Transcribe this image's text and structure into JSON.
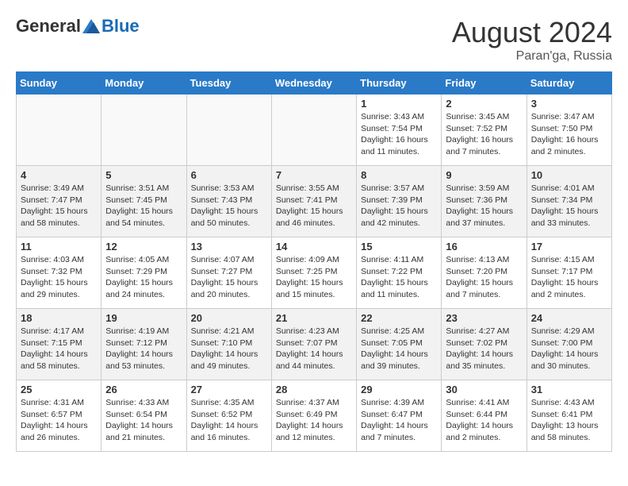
{
  "header": {
    "logo_general": "General",
    "logo_blue": "Blue",
    "month_title": "August 2024",
    "location": "Paran'ga, Russia"
  },
  "days_of_week": [
    "Sunday",
    "Monday",
    "Tuesday",
    "Wednesday",
    "Thursday",
    "Friday",
    "Saturday"
  ],
  "weeks": [
    [
      {
        "day": "",
        "info": ""
      },
      {
        "day": "",
        "info": ""
      },
      {
        "day": "",
        "info": ""
      },
      {
        "day": "",
        "info": ""
      },
      {
        "day": "1",
        "info": "Sunrise: 3:43 AM\nSunset: 7:54 PM\nDaylight: 16 hours\nand 11 minutes."
      },
      {
        "day": "2",
        "info": "Sunrise: 3:45 AM\nSunset: 7:52 PM\nDaylight: 16 hours\nand 7 minutes."
      },
      {
        "day": "3",
        "info": "Sunrise: 3:47 AM\nSunset: 7:50 PM\nDaylight: 16 hours\nand 2 minutes."
      }
    ],
    [
      {
        "day": "4",
        "info": "Sunrise: 3:49 AM\nSunset: 7:47 PM\nDaylight: 15 hours\nand 58 minutes."
      },
      {
        "day": "5",
        "info": "Sunrise: 3:51 AM\nSunset: 7:45 PM\nDaylight: 15 hours\nand 54 minutes."
      },
      {
        "day": "6",
        "info": "Sunrise: 3:53 AM\nSunset: 7:43 PM\nDaylight: 15 hours\nand 50 minutes."
      },
      {
        "day": "7",
        "info": "Sunrise: 3:55 AM\nSunset: 7:41 PM\nDaylight: 15 hours\nand 46 minutes."
      },
      {
        "day": "8",
        "info": "Sunrise: 3:57 AM\nSunset: 7:39 PM\nDaylight: 15 hours\nand 42 minutes."
      },
      {
        "day": "9",
        "info": "Sunrise: 3:59 AM\nSunset: 7:36 PM\nDaylight: 15 hours\nand 37 minutes."
      },
      {
        "day": "10",
        "info": "Sunrise: 4:01 AM\nSunset: 7:34 PM\nDaylight: 15 hours\nand 33 minutes."
      }
    ],
    [
      {
        "day": "11",
        "info": "Sunrise: 4:03 AM\nSunset: 7:32 PM\nDaylight: 15 hours\nand 29 minutes."
      },
      {
        "day": "12",
        "info": "Sunrise: 4:05 AM\nSunset: 7:29 PM\nDaylight: 15 hours\nand 24 minutes."
      },
      {
        "day": "13",
        "info": "Sunrise: 4:07 AM\nSunset: 7:27 PM\nDaylight: 15 hours\nand 20 minutes."
      },
      {
        "day": "14",
        "info": "Sunrise: 4:09 AM\nSunset: 7:25 PM\nDaylight: 15 hours\nand 15 minutes."
      },
      {
        "day": "15",
        "info": "Sunrise: 4:11 AM\nSunset: 7:22 PM\nDaylight: 15 hours\nand 11 minutes."
      },
      {
        "day": "16",
        "info": "Sunrise: 4:13 AM\nSunset: 7:20 PM\nDaylight: 15 hours\nand 7 minutes."
      },
      {
        "day": "17",
        "info": "Sunrise: 4:15 AM\nSunset: 7:17 PM\nDaylight: 15 hours\nand 2 minutes."
      }
    ],
    [
      {
        "day": "18",
        "info": "Sunrise: 4:17 AM\nSunset: 7:15 PM\nDaylight: 14 hours\nand 58 minutes."
      },
      {
        "day": "19",
        "info": "Sunrise: 4:19 AM\nSunset: 7:12 PM\nDaylight: 14 hours\nand 53 minutes."
      },
      {
        "day": "20",
        "info": "Sunrise: 4:21 AM\nSunset: 7:10 PM\nDaylight: 14 hours\nand 49 minutes."
      },
      {
        "day": "21",
        "info": "Sunrise: 4:23 AM\nSunset: 7:07 PM\nDaylight: 14 hours\nand 44 minutes."
      },
      {
        "day": "22",
        "info": "Sunrise: 4:25 AM\nSunset: 7:05 PM\nDaylight: 14 hours\nand 39 minutes."
      },
      {
        "day": "23",
        "info": "Sunrise: 4:27 AM\nSunset: 7:02 PM\nDaylight: 14 hours\nand 35 minutes."
      },
      {
        "day": "24",
        "info": "Sunrise: 4:29 AM\nSunset: 7:00 PM\nDaylight: 14 hours\nand 30 minutes."
      }
    ],
    [
      {
        "day": "25",
        "info": "Sunrise: 4:31 AM\nSunset: 6:57 PM\nDaylight: 14 hours\nand 26 minutes."
      },
      {
        "day": "26",
        "info": "Sunrise: 4:33 AM\nSunset: 6:54 PM\nDaylight: 14 hours\nand 21 minutes."
      },
      {
        "day": "27",
        "info": "Sunrise: 4:35 AM\nSunset: 6:52 PM\nDaylight: 14 hours\nand 16 minutes."
      },
      {
        "day": "28",
        "info": "Sunrise: 4:37 AM\nSunset: 6:49 PM\nDaylight: 14 hours\nand 12 minutes."
      },
      {
        "day": "29",
        "info": "Sunrise: 4:39 AM\nSunset: 6:47 PM\nDaylight: 14 hours\nand 7 minutes."
      },
      {
        "day": "30",
        "info": "Sunrise: 4:41 AM\nSunset: 6:44 PM\nDaylight: 14 hours\nand 2 minutes."
      },
      {
        "day": "31",
        "info": "Sunrise: 4:43 AM\nSunset: 6:41 PM\nDaylight: 13 hours\nand 58 minutes."
      }
    ]
  ]
}
